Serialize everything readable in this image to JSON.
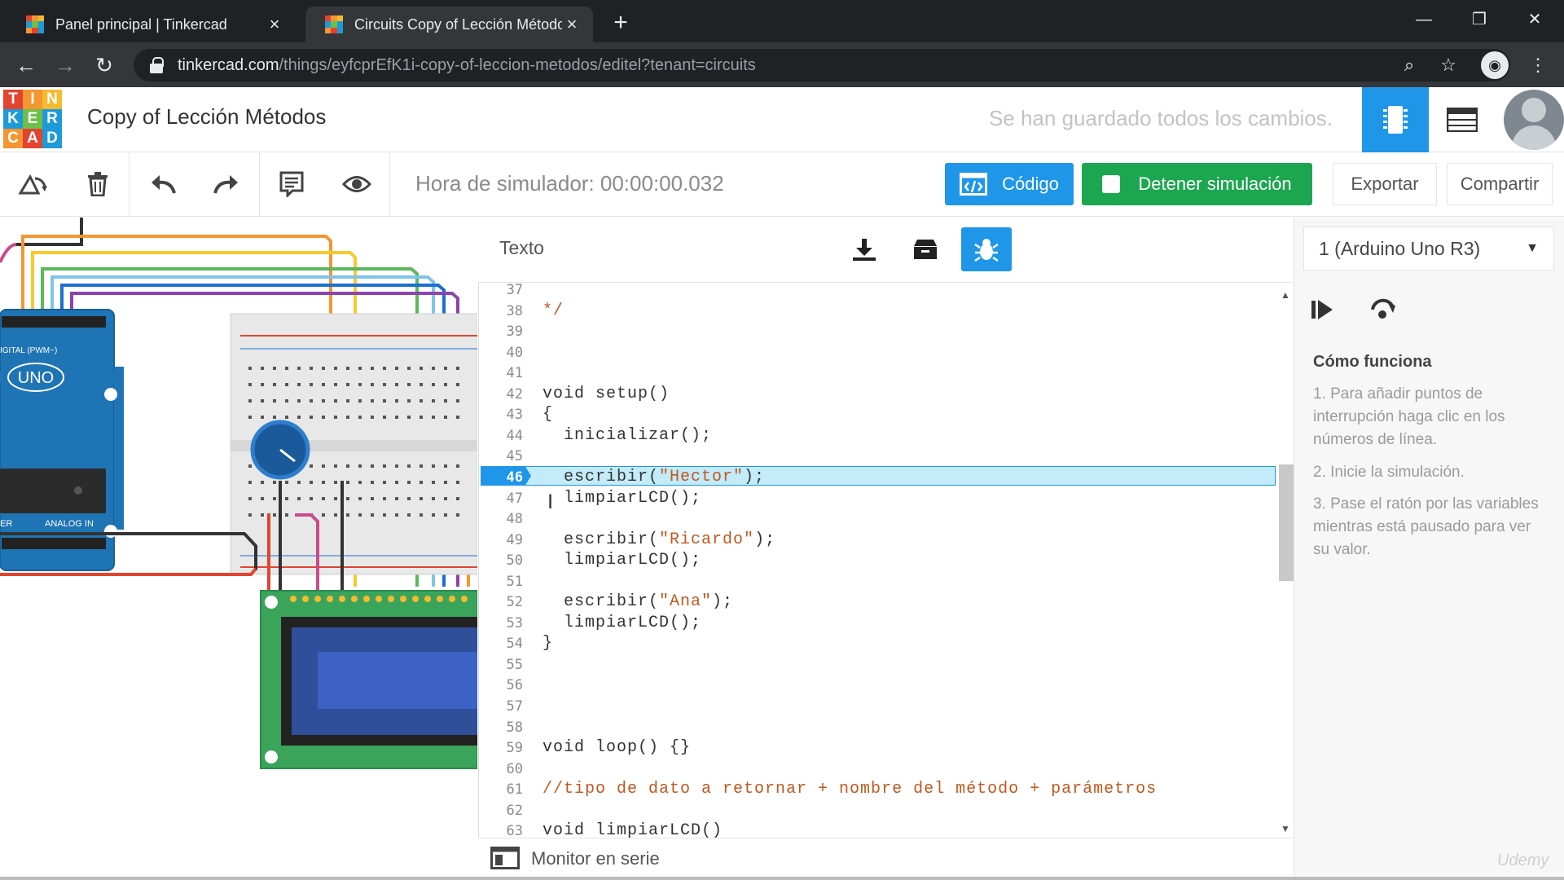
{
  "browser": {
    "tabs": [
      {
        "title": "Panel principal | Tinkercad",
        "active": false
      },
      {
        "title": "Circuits Copy of Lección Métodos",
        "active": true
      }
    ],
    "url_domain": "tinkercad.com",
    "url_path": "/things/eyfcprEfK1i-copy-of-leccion-metodos/editel?tenant=circuits"
  },
  "logo": {
    "letters": [
      "T",
      "I",
      "N",
      "K",
      "E",
      "R",
      "C",
      "A",
      "D"
    ],
    "colors": [
      "#e2442f",
      "#f49631",
      "#f6ba2f",
      "#1d9bd8",
      "#6dbf4a",
      "#1d9bd8",
      "#f49631",
      "#e2442f",
      "#1d9bd8"
    ]
  },
  "header": {
    "title": "Copy of Lección Métodos",
    "save_status": "Se han guardado todos los cambios."
  },
  "toolbar": {
    "sim_time": "Hora de simulador: 00:00:00.032",
    "code_button": "Código",
    "stop_button": "Detener simulación",
    "export_button": "Exportar",
    "share_button": "Compartir"
  },
  "code_panel": {
    "mode_label": "Texto",
    "highlight_line": 46,
    "lines": [
      {
        "n": "37",
        "text": ""
      },
      {
        "n": "38",
        "text": "*/"
      },
      {
        "n": "39",
        "text": ""
      },
      {
        "n": "40",
        "text": ""
      },
      {
        "n": "41",
        "text": ""
      },
      {
        "n": "42",
        "text": "void setup()"
      },
      {
        "n": "43",
        "text": "{"
      },
      {
        "n": "44",
        "text": "  inicializar();"
      },
      {
        "n": "45",
        "text": ""
      },
      {
        "n": "46",
        "text": "  escribir(\"Hector\");"
      },
      {
        "n": "47",
        "text": "  limpiarLCD();"
      },
      {
        "n": "48",
        "text": ""
      },
      {
        "n": "49",
        "text": "  escribir(\"Ricardo\");"
      },
      {
        "n": "50",
        "text": "  limpiarLCD();"
      },
      {
        "n": "51",
        "text": ""
      },
      {
        "n": "52",
        "text": "  escribir(\"Ana\");"
      },
      {
        "n": "53",
        "text": "  limpiarLCD();"
      },
      {
        "n": "54",
        "text": "}"
      },
      {
        "n": "55",
        "text": ""
      },
      {
        "n": "56",
        "text": ""
      },
      {
        "n": "57",
        "text": ""
      },
      {
        "n": "58",
        "text": ""
      },
      {
        "n": "59",
        "text": "void loop() {}"
      },
      {
        "n": "60",
        "text": ""
      },
      {
        "n": "61",
        "text": "//tipo de dato a retornar + nombre del método + parámetros"
      },
      {
        "n": "62",
        "text": ""
      },
      {
        "n": "63",
        "text": "void limpiarLCD()"
      }
    ],
    "serial_monitor_label": "Monitor en serie"
  },
  "debugger": {
    "device": "1 (Arduino Uno R3)",
    "how_title": "Cómo funciona",
    "steps": [
      "1. Para añadir puntos de interrupción haga clic en los números de línea.",
      "2. Inicie la simulación.",
      "3. Pase el ratón por las variables mientras está pausado para ver su valor."
    ]
  },
  "watermark": "Udemy",
  "colors": {
    "accent_blue": "#1f96e8",
    "stop_green": "#1da650",
    "highlight": "#c3ebfa",
    "comment_orange": "#c0581e",
    "string_orange": "#c0581e"
  }
}
